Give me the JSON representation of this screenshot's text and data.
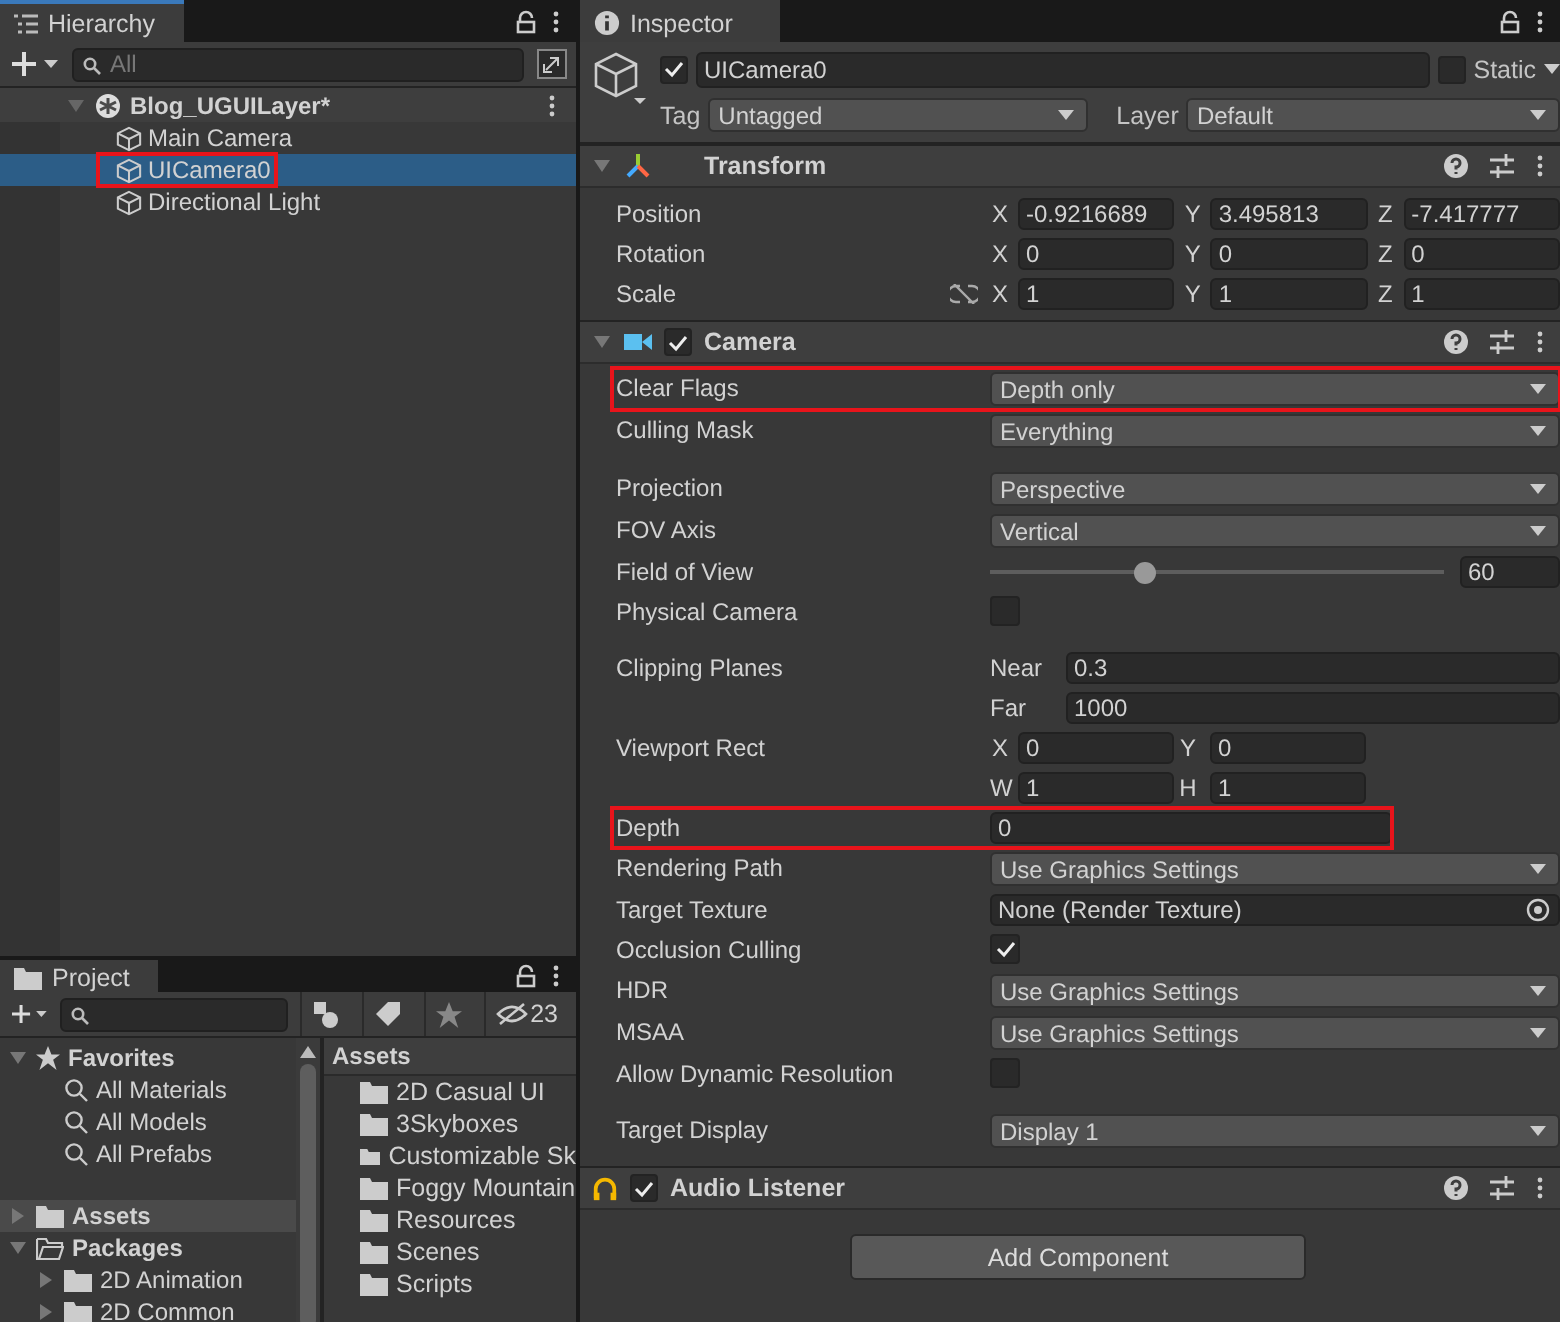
{
  "hierarchy": {
    "title": "Hierarchy",
    "search_placeholder": "All",
    "scene": {
      "name": "Blog_UGUILayer*",
      "expanded": true
    },
    "items": [
      {
        "label": "Main Camera",
        "selected": false,
        "marked": false
      },
      {
        "label": "UICamera0",
        "selected": true,
        "marked": true
      },
      {
        "label": "Directional Light",
        "selected": false,
        "marked": false
      }
    ]
  },
  "project": {
    "title": "Project",
    "hidden_count": "23",
    "favorites": {
      "label": "Favorites",
      "expanded": true,
      "items": [
        "All Materials",
        "All Models",
        "All Prefabs"
      ]
    },
    "tree": [
      {
        "label": "Assets",
        "expanded": false,
        "selected": true
      },
      {
        "label": "Packages",
        "expanded": true,
        "selected": false,
        "children": [
          {
            "label": "2D Animation",
            "expanded": false,
            "selected": false
          },
          {
            "label": "2D Common",
            "expanded": false,
            "selected": false
          }
        ]
      }
    ],
    "assets_header": "Assets",
    "assets": [
      "2D Casual UI",
      "3Skyboxes",
      "Customizable Sk",
      "Foggy Mountain",
      "Resources",
      "Scenes",
      "Scripts"
    ]
  },
  "inspector": {
    "title": "Inspector",
    "object": {
      "active": true,
      "name": "UICamera0",
      "static": false,
      "static_label": "Static",
      "tag_label": "Tag",
      "tag": "Untagged",
      "layer_label": "Layer",
      "layer": "Default"
    },
    "transform": {
      "title": "Transform",
      "rows": [
        {
          "label": "Position",
          "linked": false,
          "fields": [
            {
              "axis": "X",
              "value": "-0.9216689"
            },
            {
              "axis": "Y",
              "value": "3.495813"
            },
            {
              "axis": "Z",
              "value": "-7.417777"
            }
          ]
        },
        {
          "label": "Rotation",
          "linked": false,
          "fields": [
            {
              "axis": "X",
              "value": "0"
            },
            {
              "axis": "Y",
              "value": "0"
            },
            {
              "axis": "Z",
              "value": "0"
            }
          ]
        },
        {
          "label": "Scale",
          "linked": true,
          "fields": [
            {
              "axis": "X",
              "value": "1"
            },
            {
              "axis": "Y",
              "value": "1"
            },
            {
              "axis": "Z",
              "value": "1"
            }
          ]
        }
      ]
    },
    "camera": {
      "title": "Camera",
      "enabled": true,
      "groups": [
        [
          {
            "kind": "dropdown",
            "label": "Clear Flags",
            "value": "Depth only",
            "marked": true
          },
          {
            "kind": "dropdown",
            "label": "Culling Mask",
            "value": "Everything",
            "marked": false
          }
        ],
        [
          {
            "kind": "dropdown",
            "label": "Projection",
            "value": "Perspective",
            "marked": false
          },
          {
            "kind": "dropdown",
            "label": "FOV Axis",
            "value": "Vertical",
            "marked": false
          },
          {
            "kind": "slider",
            "label": "Field of View",
            "level": 0.34,
            "value": "60",
            "marked": false
          },
          {
            "kind": "checkbox",
            "label": "Physical Camera",
            "checked": false,
            "marked": false
          }
        ],
        [
          {
            "kind": "pair",
            "label": "Clipping Planes",
            "marked": false,
            "fields": [
              {
                "label": "Near",
                "value": "0.3"
              },
              {
                "label": "Far",
                "value": "1000"
              }
            ]
          },
          {
            "kind": "rect",
            "label": "Viewport Rect",
            "marked": false,
            "fields": [
              {
                "label": "X",
                "value": "0"
              },
              {
                "label": "Y",
                "value": "0"
              },
              {
                "label": "W",
                "value": "1"
              },
              {
                "label": "H",
                "value": "1"
              }
            ]
          },
          {
            "kind": "number",
            "label": "Depth",
            "value": "0",
            "marked": true
          },
          {
            "kind": "dropdown",
            "label": "Rendering Path",
            "value": "Use Graphics Settings",
            "marked": false
          },
          {
            "kind": "object",
            "label": "Target Texture",
            "value": "None (Render Texture)",
            "marked": false
          },
          {
            "kind": "checkbox",
            "label": "Occlusion Culling",
            "checked": true,
            "marked": false
          },
          {
            "kind": "dropdown",
            "label": "HDR",
            "value": "Use Graphics Settings",
            "marked": false
          },
          {
            "kind": "dropdown",
            "label": "MSAA",
            "value": "Use Graphics Settings",
            "marked": false
          },
          {
            "kind": "checkbox",
            "label": "Allow Dynamic Resolution",
            "checked": false,
            "marked": false
          }
        ],
        [
          {
            "kind": "dropdown",
            "label": "Target Display",
            "value": "Display 1",
            "marked": false
          }
        ]
      ]
    },
    "audio": {
      "title": "Audio Listener",
      "enabled": true
    },
    "add_button": "Add Component"
  }
}
